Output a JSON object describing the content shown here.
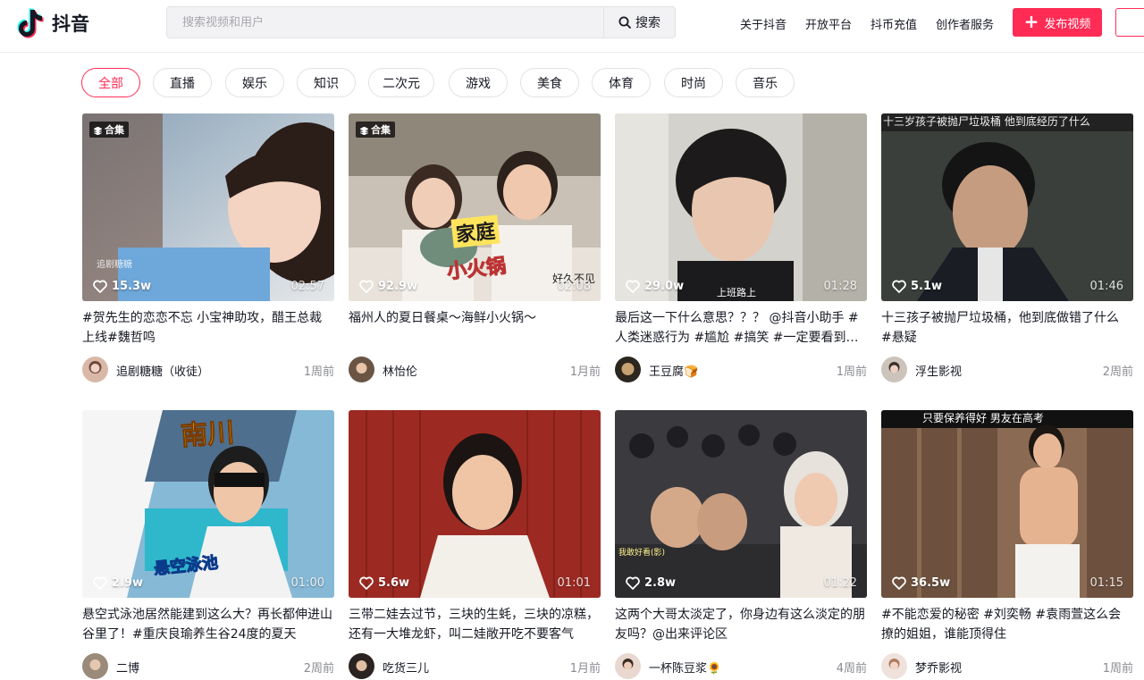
{
  "header": {
    "logo_text": "抖音",
    "search_placeholder": "搜索视频和用户",
    "search_button": "搜索",
    "nav": [
      "关于抖音",
      "开放平台",
      "抖币充值",
      "创作者服务"
    ],
    "publish_button": "发布视频"
  },
  "colors": {
    "brand": "#fe2c55",
    "text": "#161823",
    "muted": "#8a8b91"
  },
  "categories": [
    {
      "label": "全部",
      "active": true
    },
    {
      "label": "直播"
    },
    {
      "label": "娱乐"
    },
    {
      "label": "知识"
    },
    {
      "label": "二次元"
    },
    {
      "label": "游戏"
    },
    {
      "label": "美食"
    },
    {
      "label": "体育"
    },
    {
      "label": "时尚"
    },
    {
      "label": "音乐"
    }
  ],
  "videos": [
    {
      "badge": "合集",
      "likes": "15.3w",
      "duration": "02:57",
      "title": "#贺先生的恋恋不忘 小宝神助攻，醋王总裁上线#魏哲鸣",
      "author": "追剧糖糖（收徒）",
      "time": "1周前",
      "overlay": "追剧糖糖"
    },
    {
      "badge": "合集",
      "likes": "92.9w",
      "duration": "02:08",
      "title": "福州人的夏日餐桌～海鲜小火锅～",
      "author": "林怡伦",
      "time": "1月前",
      "overlay": "家庭",
      "overlay2": "小火锅",
      "overlay3": "好久不见"
    },
    {
      "likes": "29.0w",
      "duration": "01:28",
      "title": "最后这一下什么意思？？？ @抖音小助手 #人类迷惑行为 #尴尬 #搞笑 #一定要看到最后",
      "author": "王豆腐🍞",
      "time": "1周前",
      "overlay": "上班路上"
    },
    {
      "likes": "5.1w",
      "duration": "01:46",
      "title": "十三孩子被抛尸垃圾桶，他到底做错了什么 #悬疑",
      "author": "浮生影视",
      "time": "2周前",
      "overlay": "十三岁孩子被抛尸垃圾桶 他到底经历了什么"
    },
    {
      "likes": "2.9w",
      "duration": "01:00",
      "title": "悬空式泳池居然能建到这么大？再长都伸进山谷里了！#重庆良瑜养生谷24度的夏天",
      "author": "二博",
      "time": "2周前",
      "overlay": "南川",
      "overlay2": "悬空泳池"
    },
    {
      "likes": "5.6w",
      "duration": "01:01",
      "title": "三带二娃去过节，三块的生蚝，三块的凉糕，还有一大堆龙虾，叫二娃敞开吃不要客气",
      "author": "吃货三儿",
      "time": "1月前"
    },
    {
      "likes": "2.8w",
      "duration": "01:22",
      "title": "这两个大哥太淡定了，你身边有这么淡定的朋友吗？@出来评论区",
      "author": "一杯陈豆浆🌻",
      "time": "4周前",
      "overlay": "我敢好看(影)"
    },
    {
      "likes": "36.5w",
      "duration": "01:15",
      "title": "#不能恋爱的秘密 #刘奕畅 #袁雨萱这么会撩的姐姐，谁能顶得住",
      "author": "梦乔影视",
      "time": "1周前",
      "overlay": "只要保养得好 男友在高考"
    }
  ]
}
